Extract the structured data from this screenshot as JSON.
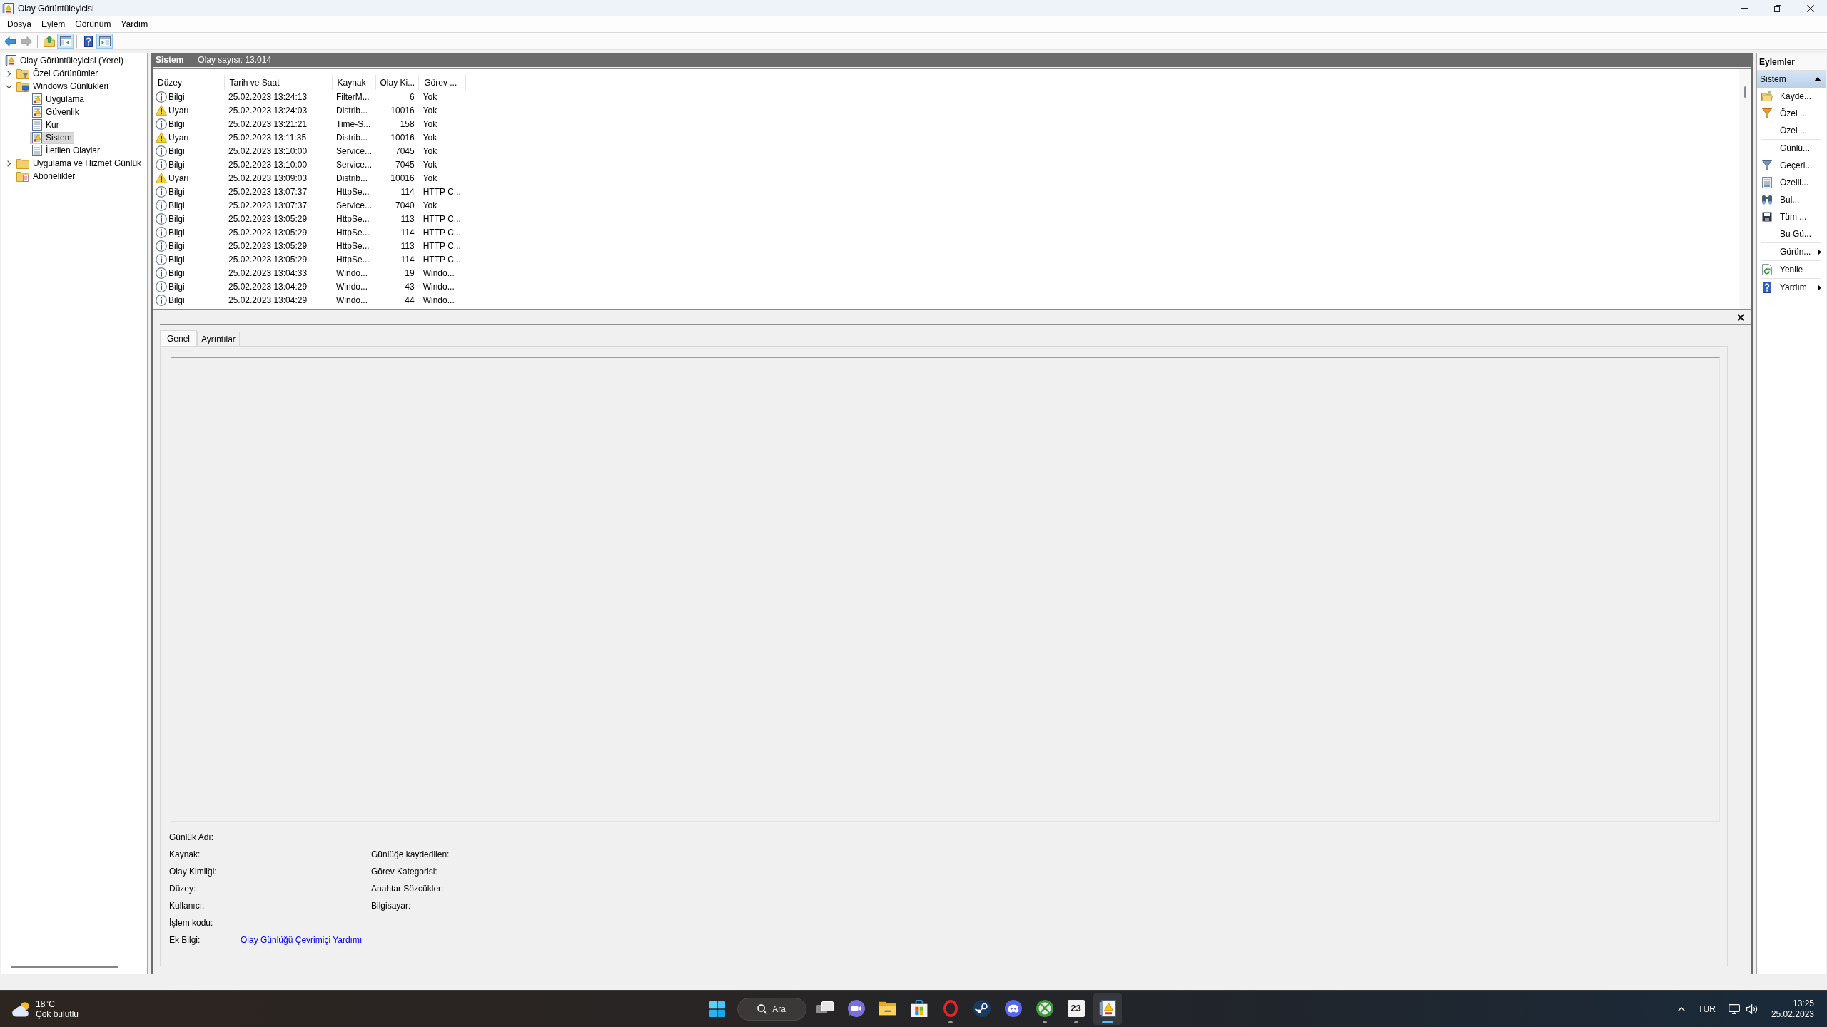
{
  "window": {
    "title": "Olay Görüntüleyicisi"
  },
  "menu": [
    "Dosya",
    "Eylem",
    "Görünüm",
    "Yardım"
  ],
  "toolbar": [
    {
      "kind": "back",
      "disabled": false,
      "pressed": false
    },
    {
      "kind": "forward",
      "disabled": true,
      "pressed": false
    },
    {
      "kind": "separator"
    },
    {
      "kind": "up",
      "disabled": false,
      "pressed": false
    },
    {
      "kind": "tree",
      "disabled": false,
      "pressed": true
    },
    {
      "kind": "separator"
    },
    {
      "kind": "help",
      "disabled": false,
      "pressed": false
    },
    {
      "kind": "actions",
      "disabled": false,
      "pressed": true
    }
  ],
  "tree": [
    {
      "label": "Olay Görüntüleyicisi (Yerel)",
      "kind": "viewer",
      "selected": false,
      "children": [
        {
          "label": "Özel Görünümler",
          "kind": "views",
          "selected": false,
          "expanded": false
        },
        {
          "label": "Windows Günlükleri",
          "kind": "windows",
          "selected": false,
          "expanded": true,
          "children": [
            {
              "label": "Uygulama",
              "kind": "marked",
              "selected": false
            },
            {
              "label": "Güvenlik",
              "kind": "marked",
              "selected": false
            },
            {
              "label": "Kur",
              "kind": "plain",
              "selected": false
            },
            {
              "label": "Sistem",
              "kind": "marked",
              "selected": true
            },
            {
              "label": "İletilen Olaylar",
              "kind": "plain",
              "selected": false
            }
          ]
        },
        {
          "label": "Uygulama ve Hizmet Günlük",
          "kind": "folder",
          "selected": false,
          "expanded": false
        },
        {
          "label": "Abonelikler",
          "kind": "subscriptions",
          "selected": false
        }
      ]
    }
  ],
  "log_header": {
    "title": "Sistem",
    "count": "Olay sayısı: 13.014"
  },
  "events": {
    "columns": [
      "Düzey",
      "Tarih ve Saat",
      "Kaynak",
      "Olay Ki...",
      "Görev ..."
    ],
    "rows": [
      {
        "kind": "info",
        "selected": false,
        "cells": [
          "Bilgi",
          "25.02.2023 13:24:13",
          "FilterM...",
          "6",
          "Yok"
        ]
      },
      {
        "kind": "warning",
        "selected": false,
        "cells": [
          "Uyarı",
          "25.02.2023 13:24:03",
          "Distrib...",
          "10016",
          "Yok"
        ]
      },
      {
        "kind": "info",
        "selected": false,
        "cells": [
          "Bilgi",
          "25.02.2023 13:21:21",
          "Time-S...",
          "158",
          "Yok"
        ]
      },
      {
        "kind": "warning",
        "selected": false,
        "cells": [
          "Uyarı",
          "25.02.2023 13:11:35",
          "Distrib...",
          "10016",
          "Yok"
        ]
      },
      {
        "kind": "info",
        "selected": false,
        "cells": [
          "Bilgi",
          "25.02.2023 13:10:00",
          "Service...",
          "7045",
          "Yok"
        ]
      },
      {
        "kind": "info",
        "selected": false,
        "cells": [
          "Bilgi",
          "25.02.2023 13:10:00",
          "Service...",
          "7045",
          "Yok"
        ]
      },
      {
        "kind": "warning",
        "selected": false,
        "cells": [
          "Uyarı",
          "25.02.2023 13:09:03",
          "Distrib...",
          "10016",
          "Yok"
        ]
      },
      {
        "kind": "info",
        "selected": false,
        "cells": [
          "Bilgi",
          "25.02.2023 13:07:37",
          "HttpSe...",
          "114",
          "HTTP C..."
        ]
      },
      {
        "kind": "info",
        "selected": false,
        "cells": [
          "Bilgi",
          "25.02.2023 13:07:37",
          "Service...",
          "7040",
          "Yok"
        ]
      },
      {
        "kind": "info",
        "selected": false,
        "cells": [
          "Bilgi",
          "25.02.2023 13:05:29",
          "HttpSe...",
          "113",
          "HTTP C..."
        ]
      },
      {
        "kind": "info",
        "selected": false,
        "cells": [
          "Bilgi",
          "25.02.2023 13:05:29",
          "HttpSe...",
          "114",
          "HTTP C..."
        ]
      },
      {
        "kind": "info",
        "selected": false,
        "cells": [
          "Bilgi",
          "25.02.2023 13:05:29",
          "HttpSe...",
          "113",
          "HTTP C..."
        ]
      },
      {
        "kind": "info",
        "selected": false,
        "cells": [
          "Bilgi",
          "25.02.2023 13:05:29",
          "HttpSe...",
          "114",
          "HTTP C..."
        ]
      },
      {
        "kind": "info",
        "selected": false,
        "cells": [
          "Bilgi",
          "25.02.2023 13:04:33",
          "Windo...",
          "19",
          "Windo..."
        ]
      },
      {
        "kind": "info",
        "selected": false,
        "cells": [
          "Bilgi",
          "25.02.2023 13:04:29",
          "Windo...",
          "43",
          "Windo..."
        ]
      },
      {
        "kind": "info",
        "selected": false,
        "cells": [
          "Bilgi",
          "25.02.2023 13:04:29",
          "Windo...",
          "44",
          "Windo..."
        ]
      }
    ]
  },
  "details": {
    "tabs": [
      {
        "label": "Genel",
        "selected": true
      },
      {
        "label": "Ayrıntılar",
        "selected": false
      }
    ],
    "fields": [
      {
        "label": "Günlük Adı:"
      },
      {
        "label": "Kaynak:",
        "right_label": "Günlüğe kaydedilen:"
      },
      {
        "label": "Olay Kimliği:",
        "right_label": "Görev Kategorisi:"
      },
      {
        "label": "Düzey:",
        "right_label": "Anahtar Sözcükler:"
      },
      {
        "label": "Kullanıcı:",
        "right_label": "Bilgisayar:"
      },
      {
        "label": "İşlem kodu:"
      },
      {
        "label": "Ek Bilgi:",
        "link": "Olay Günlüğü Çevrimiçi Yardımı"
      }
    ]
  },
  "actions": {
    "title": "Eylemler",
    "section": {
      "label": "Sistem",
      "expanded": true
    },
    "groups": [
      [
        {
          "label": "Kayde...",
          "kind": "open",
          "submenu": false
        },
        {
          "label": "Özel ...",
          "kind": "create",
          "submenu": false
        },
        {
          "label": "Özel ...",
          "kind": "plain",
          "submenu": false
        }
      ],
      [
        {
          "label": "Günlü...",
          "kind": "plain",
          "submenu": false
        },
        {
          "label": "Geçerl...",
          "kind": "filter",
          "submenu": false
        },
        {
          "label": "Özelli...",
          "kind": "properties",
          "submenu": false
        },
        {
          "label": "Bul...",
          "kind": "find",
          "submenu": false
        },
        {
          "label": "Tüm ...",
          "kind": "save",
          "submenu": false
        },
        {
          "label": "Bu Gü...",
          "kind": "plain",
          "submenu": false
        }
      ],
      [
        {
          "label": "Görün...",
          "kind": "plain",
          "submenu": true
        }
      ],
      [
        {
          "label": "Yenile",
          "kind": "refresh",
          "submenu": false
        }
      ],
      [
        {
          "label": "Yardım",
          "kind": "help",
          "submenu": true
        }
      ]
    ]
  },
  "taskbar": {
    "weather": {
      "temperature": "18°C",
      "condition": "Çok bulutlu"
    },
    "search": {
      "label": "Ara"
    },
    "apps": [
      {
        "kind": "taskview",
        "running": false,
        "active": false
      },
      {
        "kind": "chat",
        "running": false,
        "active": false
      },
      {
        "kind": "explorer",
        "running": false,
        "active": false
      },
      {
        "kind": "store",
        "running": false,
        "active": false
      },
      {
        "kind": "opera",
        "running": true,
        "active": false
      },
      {
        "kind": "steam",
        "running": false,
        "active": false
      },
      {
        "kind": "discord",
        "running": false,
        "active": false
      },
      {
        "kind": "xbox",
        "running": true,
        "active": false
      },
      {
        "kind": "tile",
        "text": "23",
        "running": true,
        "active": false
      },
      {
        "kind": "eventviewer",
        "running": true,
        "active": true
      }
    ],
    "tray": {
      "language": "TUR",
      "time": "13:25",
      "date": "25.02.2023"
    }
  }
}
